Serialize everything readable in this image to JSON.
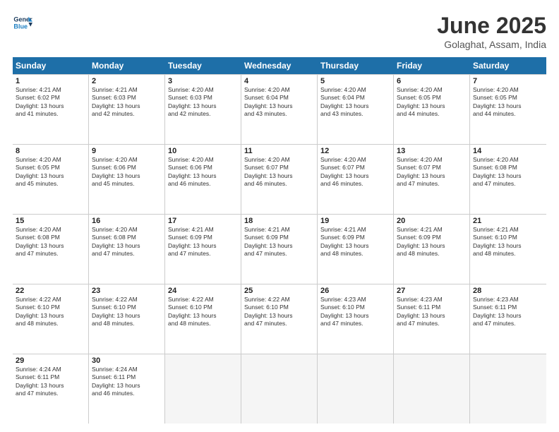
{
  "header": {
    "logo_line1": "General",
    "logo_line2": "Blue",
    "title": "June 2025",
    "location": "Golaghat, Assam, India"
  },
  "weekdays": [
    "Sunday",
    "Monday",
    "Tuesday",
    "Wednesday",
    "Thursday",
    "Friday",
    "Saturday"
  ],
  "rows": [
    [
      {
        "day": "",
        "info": ""
      },
      {
        "day": "2",
        "info": "Sunrise: 4:21 AM\nSunset: 6:03 PM\nDaylight: 13 hours\nand 42 minutes."
      },
      {
        "day": "3",
        "info": "Sunrise: 4:20 AM\nSunset: 6:03 PM\nDaylight: 13 hours\nand 42 minutes."
      },
      {
        "day": "4",
        "info": "Sunrise: 4:20 AM\nSunset: 6:04 PM\nDaylight: 13 hours\nand 43 minutes."
      },
      {
        "day": "5",
        "info": "Sunrise: 4:20 AM\nSunset: 6:04 PM\nDaylight: 13 hours\nand 43 minutes."
      },
      {
        "day": "6",
        "info": "Sunrise: 4:20 AM\nSunset: 6:05 PM\nDaylight: 13 hours\nand 44 minutes."
      },
      {
        "day": "7",
        "info": "Sunrise: 4:20 AM\nSunset: 6:05 PM\nDaylight: 13 hours\nand 44 minutes."
      },
      {
        "day": "1",
        "info": "Sunrise: 4:21 AM\nSunset: 6:02 PM\nDaylight: 13 hours\nand 41 minutes."
      }
    ],
    [
      {
        "day": "8",
        "info": "Sunrise: 4:20 AM\nSunset: 6:05 PM\nDaylight: 13 hours\nand 45 minutes."
      },
      {
        "day": "9",
        "info": "Sunrise: 4:20 AM\nSunset: 6:06 PM\nDaylight: 13 hours\nand 45 minutes."
      },
      {
        "day": "10",
        "info": "Sunrise: 4:20 AM\nSunset: 6:06 PM\nDaylight: 13 hours\nand 46 minutes."
      },
      {
        "day": "11",
        "info": "Sunrise: 4:20 AM\nSunset: 6:07 PM\nDaylight: 13 hours\nand 46 minutes."
      },
      {
        "day": "12",
        "info": "Sunrise: 4:20 AM\nSunset: 6:07 PM\nDaylight: 13 hours\nand 46 minutes."
      },
      {
        "day": "13",
        "info": "Sunrise: 4:20 AM\nSunset: 6:07 PM\nDaylight: 13 hours\nand 47 minutes."
      },
      {
        "day": "14",
        "info": "Sunrise: 4:20 AM\nSunset: 6:08 PM\nDaylight: 13 hours\nand 47 minutes."
      }
    ],
    [
      {
        "day": "15",
        "info": "Sunrise: 4:20 AM\nSunset: 6:08 PM\nDaylight: 13 hours\nand 47 minutes."
      },
      {
        "day": "16",
        "info": "Sunrise: 4:20 AM\nSunset: 6:08 PM\nDaylight: 13 hours\nand 47 minutes."
      },
      {
        "day": "17",
        "info": "Sunrise: 4:21 AM\nSunset: 6:09 PM\nDaylight: 13 hours\nand 47 minutes."
      },
      {
        "day": "18",
        "info": "Sunrise: 4:21 AM\nSunset: 6:09 PM\nDaylight: 13 hours\nand 47 minutes."
      },
      {
        "day": "19",
        "info": "Sunrise: 4:21 AM\nSunset: 6:09 PM\nDaylight: 13 hours\nand 48 minutes."
      },
      {
        "day": "20",
        "info": "Sunrise: 4:21 AM\nSunset: 6:09 PM\nDaylight: 13 hours\nand 48 minutes."
      },
      {
        "day": "21",
        "info": "Sunrise: 4:21 AM\nSunset: 6:10 PM\nDaylight: 13 hours\nand 48 minutes."
      }
    ],
    [
      {
        "day": "22",
        "info": "Sunrise: 4:22 AM\nSunset: 6:10 PM\nDaylight: 13 hours\nand 48 minutes."
      },
      {
        "day": "23",
        "info": "Sunrise: 4:22 AM\nSunset: 6:10 PM\nDaylight: 13 hours\nand 48 minutes."
      },
      {
        "day": "24",
        "info": "Sunrise: 4:22 AM\nSunset: 6:10 PM\nDaylight: 13 hours\nand 48 minutes."
      },
      {
        "day": "25",
        "info": "Sunrise: 4:22 AM\nSunset: 6:10 PM\nDaylight: 13 hours\nand 47 minutes."
      },
      {
        "day": "26",
        "info": "Sunrise: 4:23 AM\nSunset: 6:10 PM\nDaylight: 13 hours\nand 47 minutes."
      },
      {
        "day": "27",
        "info": "Sunrise: 4:23 AM\nSunset: 6:11 PM\nDaylight: 13 hours\nand 47 minutes."
      },
      {
        "day": "28",
        "info": "Sunrise: 4:23 AM\nSunset: 6:11 PM\nDaylight: 13 hours\nand 47 minutes."
      }
    ],
    [
      {
        "day": "29",
        "info": "Sunrise: 4:24 AM\nSunset: 6:11 PM\nDaylight: 13 hours\nand 47 minutes."
      },
      {
        "day": "30",
        "info": "Sunrise: 4:24 AM\nSunset: 6:11 PM\nDaylight: 13 hours\nand 46 minutes."
      },
      {
        "day": "",
        "info": ""
      },
      {
        "day": "",
        "info": ""
      },
      {
        "day": "",
        "info": ""
      },
      {
        "day": "",
        "info": ""
      },
      {
        "day": "",
        "info": ""
      }
    ]
  ]
}
